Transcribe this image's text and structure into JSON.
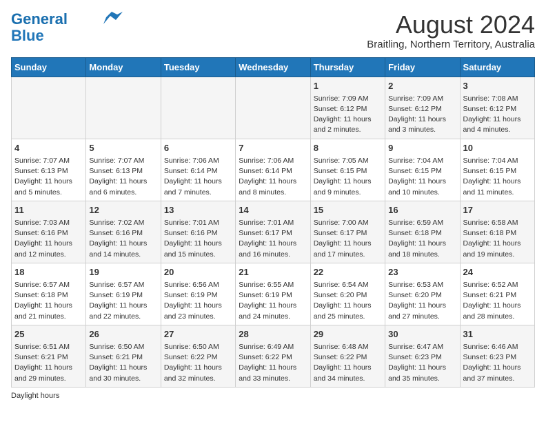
{
  "header": {
    "logo_line1": "General",
    "logo_line2": "Blue",
    "title": "August 2024",
    "subtitle": "Braitling, Northern Territory, Australia"
  },
  "days_of_week": [
    "Sunday",
    "Monday",
    "Tuesday",
    "Wednesday",
    "Thursday",
    "Friday",
    "Saturday"
  ],
  "weeks": [
    [
      {
        "day": "",
        "info": ""
      },
      {
        "day": "",
        "info": ""
      },
      {
        "day": "",
        "info": ""
      },
      {
        "day": "",
        "info": ""
      },
      {
        "day": "1",
        "info": "Sunrise: 7:09 AM\nSunset: 6:12 PM\nDaylight: 11 hours\nand 2 minutes."
      },
      {
        "day": "2",
        "info": "Sunrise: 7:09 AM\nSunset: 6:12 PM\nDaylight: 11 hours\nand 3 minutes."
      },
      {
        "day": "3",
        "info": "Sunrise: 7:08 AM\nSunset: 6:12 PM\nDaylight: 11 hours\nand 4 minutes."
      }
    ],
    [
      {
        "day": "4",
        "info": "Sunrise: 7:07 AM\nSunset: 6:13 PM\nDaylight: 11 hours\nand 5 minutes."
      },
      {
        "day": "5",
        "info": "Sunrise: 7:07 AM\nSunset: 6:13 PM\nDaylight: 11 hours\nand 6 minutes."
      },
      {
        "day": "6",
        "info": "Sunrise: 7:06 AM\nSunset: 6:14 PM\nDaylight: 11 hours\nand 7 minutes."
      },
      {
        "day": "7",
        "info": "Sunrise: 7:06 AM\nSunset: 6:14 PM\nDaylight: 11 hours\nand 8 minutes."
      },
      {
        "day": "8",
        "info": "Sunrise: 7:05 AM\nSunset: 6:15 PM\nDaylight: 11 hours\nand 9 minutes."
      },
      {
        "day": "9",
        "info": "Sunrise: 7:04 AM\nSunset: 6:15 PM\nDaylight: 11 hours\nand 10 minutes."
      },
      {
        "day": "10",
        "info": "Sunrise: 7:04 AM\nSunset: 6:15 PM\nDaylight: 11 hours\nand 11 minutes."
      }
    ],
    [
      {
        "day": "11",
        "info": "Sunrise: 7:03 AM\nSunset: 6:16 PM\nDaylight: 11 hours\nand 12 minutes."
      },
      {
        "day": "12",
        "info": "Sunrise: 7:02 AM\nSunset: 6:16 PM\nDaylight: 11 hours\nand 14 minutes."
      },
      {
        "day": "13",
        "info": "Sunrise: 7:01 AM\nSunset: 6:16 PM\nDaylight: 11 hours\nand 15 minutes."
      },
      {
        "day": "14",
        "info": "Sunrise: 7:01 AM\nSunset: 6:17 PM\nDaylight: 11 hours\nand 16 minutes."
      },
      {
        "day": "15",
        "info": "Sunrise: 7:00 AM\nSunset: 6:17 PM\nDaylight: 11 hours\nand 17 minutes."
      },
      {
        "day": "16",
        "info": "Sunrise: 6:59 AM\nSunset: 6:18 PM\nDaylight: 11 hours\nand 18 minutes."
      },
      {
        "day": "17",
        "info": "Sunrise: 6:58 AM\nSunset: 6:18 PM\nDaylight: 11 hours\nand 19 minutes."
      }
    ],
    [
      {
        "day": "18",
        "info": "Sunrise: 6:57 AM\nSunset: 6:18 PM\nDaylight: 11 hours\nand 21 minutes."
      },
      {
        "day": "19",
        "info": "Sunrise: 6:57 AM\nSunset: 6:19 PM\nDaylight: 11 hours\nand 22 minutes."
      },
      {
        "day": "20",
        "info": "Sunrise: 6:56 AM\nSunset: 6:19 PM\nDaylight: 11 hours\nand 23 minutes."
      },
      {
        "day": "21",
        "info": "Sunrise: 6:55 AM\nSunset: 6:19 PM\nDaylight: 11 hours\nand 24 minutes."
      },
      {
        "day": "22",
        "info": "Sunrise: 6:54 AM\nSunset: 6:20 PM\nDaylight: 11 hours\nand 25 minutes."
      },
      {
        "day": "23",
        "info": "Sunrise: 6:53 AM\nSunset: 6:20 PM\nDaylight: 11 hours\nand 27 minutes."
      },
      {
        "day": "24",
        "info": "Sunrise: 6:52 AM\nSunset: 6:21 PM\nDaylight: 11 hours\nand 28 minutes."
      }
    ],
    [
      {
        "day": "25",
        "info": "Sunrise: 6:51 AM\nSunset: 6:21 PM\nDaylight: 11 hours\nand 29 minutes."
      },
      {
        "day": "26",
        "info": "Sunrise: 6:50 AM\nSunset: 6:21 PM\nDaylight: 11 hours\nand 30 minutes."
      },
      {
        "day": "27",
        "info": "Sunrise: 6:50 AM\nSunset: 6:22 PM\nDaylight: 11 hours\nand 32 minutes."
      },
      {
        "day": "28",
        "info": "Sunrise: 6:49 AM\nSunset: 6:22 PM\nDaylight: 11 hours\nand 33 minutes."
      },
      {
        "day": "29",
        "info": "Sunrise: 6:48 AM\nSunset: 6:22 PM\nDaylight: 11 hours\nand 34 minutes."
      },
      {
        "day": "30",
        "info": "Sunrise: 6:47 AM\nSunset: 6:23 PM\nDaylight: 11 hours\nand 35 minutes."
      },
      {
        "day": "31",
        "info": "Sunrise: 6:46 AM\nSunset: 6:23 PM\nDaylight: 11 hours\nand 37 minutes."
      }
    ]
  ],
  "footer": {
    "note": "Daylight hours"
  }
}
